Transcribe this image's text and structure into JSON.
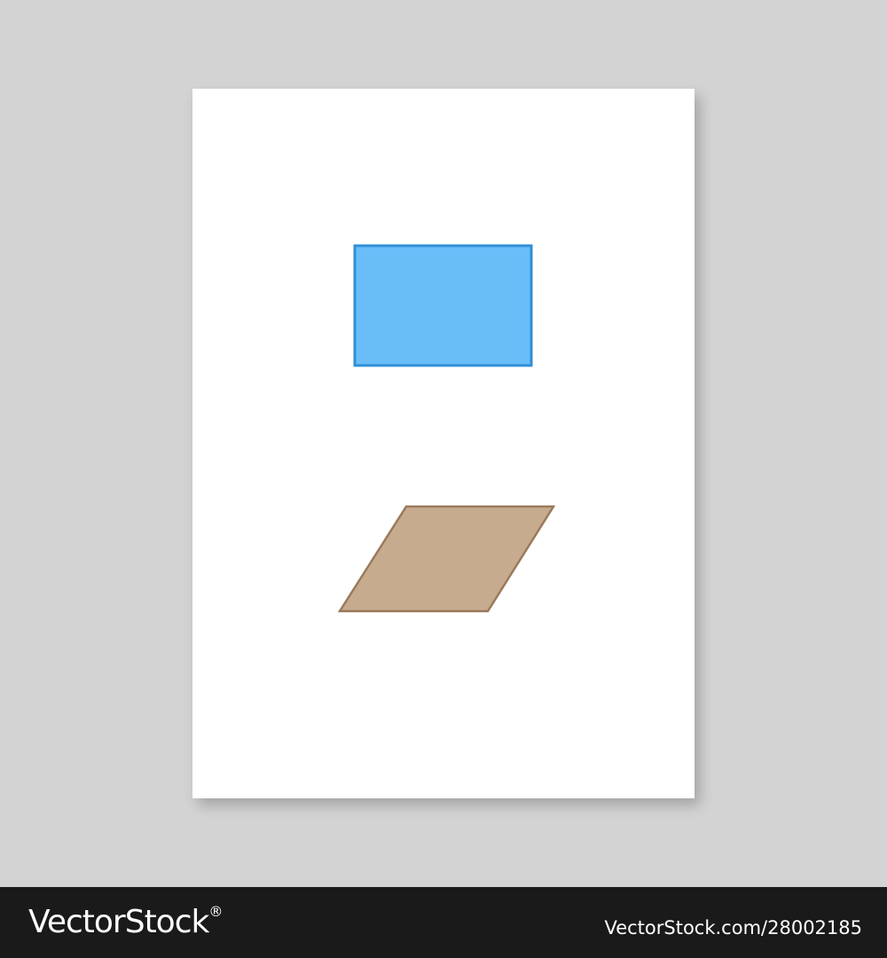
{
  "sheet": {
    "background": "#ffffff",
    "shapes": [
      {
        "name": "rectangle",
        "fill": "#6abef8",
        "stroke": "#2f8fd6"
      },
      {
        "name": "parallelogram",
        "fill": "#c7ab8e",
        "stroke": "#9a7a5c"
      }
    ]
  },
  "footer": {
    "brand": "VectorStock",
    "brand_mark": "®",
    "stock_id": "VectorStock.com/28002185",
    "background": "#1a1a1a"
  }
}
